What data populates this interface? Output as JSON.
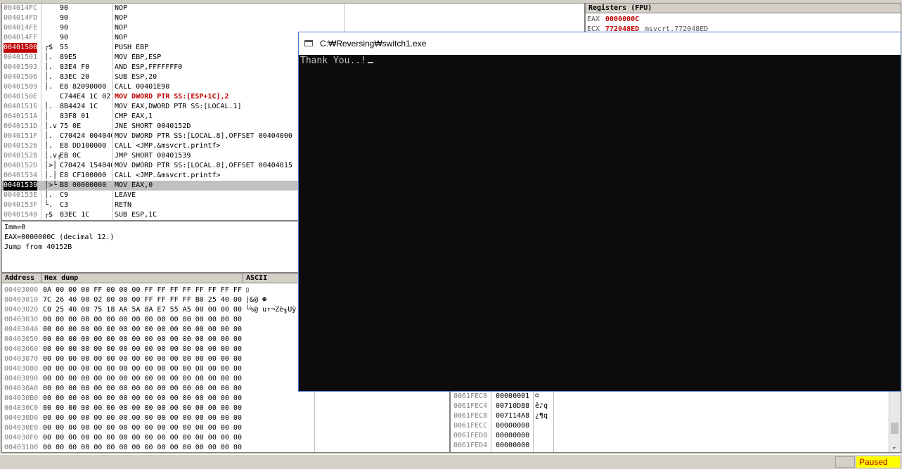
{
  "console": {
    "title": "C:₩Reversing₩switch1.exe",
    "output": "Thank You..!"
  },
  "disasm": {
    "rows": [
      {
        "addr": "004014FC",
        "arrow": "",
        "hex": "90",
        "asm": "NOP"
      },
      {
        "addr": "004014FD",
        "arrow": "",
        "hex": "90",
        "asm": "NOP"
      },
      {
        "addr": "004014FE",
        "arrow": "",
        "hex": "90",
        "asm": "NOP"
      },
      {
        "addr": "004014FF",
        "arrow": "",
        "hex": "90",
        "asm": "NOP"
      },
      {
        "addr": "00401500",
        "arrow": "┌$",
        "hex": "55",
        "asm": "PUSH EBP",
        "state": "eip"
      },
      {
        "addr": "00401501",
        "arrow": "│.",
        "hex": "89E5",
        "asm": "MOV EBP,ESP"
      },
      {
        "addr": "00401503",
        "arrow": "│.",
        "hex": "83E4 F0",
        "asm": "AND ESP,FFFFFFF0"
      },
      {
        "addr": "00401506",
        "arrow": "│.",
        "hex": "83EC 20",
        "asm": "SUB ESP,20"
      },
      {
        "addr": "00401509",
        "arrow": "│.",
        "hex": "E8 82090000",
        "asm": "CALL 00401E90"
      },
      {
        "addr": "0040150E",
        "arrow": " ",
        "hex": "C744E4 1C 02",
        "asm": "MOV DWORD PTR SS:[ESP+1C],2",
        "red": true
      },
      {
        "addr": "00401516",
        "arrow": "│.",
        "hex": "8B4424 1C",
        "asm": "MOV EAX,DWORD PTR SS:[LOCAL.1]"
      },
      {
        "addr": "0040151A",
        "arrow": "│",
        "hex": "83F8 01",
        "asm": "CMP EAX,1"
      },
      {
        "addr": "0040151D",
        "arrow": "│.v",
        "hex": "75 0E",
        "asm": "JNE SHORT 0040152D"
      },
      {
        "addr": "0040151F",
        "arrow": "│.",
        "hex": "C70424 004040",
        "asm": "MOV DWORD PTR SS:[LOCAL.8],OFFSET 00404000"
      },
      {
        "addr": "00401526",
        "arrow": "│.",
        "hex": "E8 DD100000",
        "asm": "CALL <JMP.&msvcrt.printf>"
      },
      {
        "addr": "0040152B",
        "arrow": "│.v┌",
        "hex": "EB 0C",
        "asm": "JMP SHORT 00401539"
      },
      {
        "addr": "0040152D",
        "arrow": "│>│",
        "hex": "C70424 154040",
        "asm": "MOV DWORD PTR SS:[LOCAL.8],OFFSET 00404015"
      },
      {
        "addr": "00401534",
        "arrow": "│.│",
        "hex": "E8 CF100000",
        "asm": "CALL <JMP.&msvcrt.printf>"
      },
      {
        "addr": "00401539",
        "arrow": "│>└",
        "hex": "B8 00000000",
        "asm": "MOV EAX,0",
        "state": "sel"
      },
      {
        "addr": "0040153E",
        "arrow": "│.",
        "hex": "C9",
        "asm": "LEAVE"
      },
      {
        "addr": "0040153F",
        "arrow": "└.",
        "hex": "C3",
        "asm": "RETN"
      },
      {
        "addr": "00401540",
        "arrow": "┌$",
        "hex": "83EC 1C",
        "asm": "SUB ESP,1C"
      }
    ]
  },
  "info": {
    "lines": [
      "Imm=0",
      "EAX=0000000C (decimal 12.)",
      "Jump from 40152B"
    ]
  },
  "dump": {
    "headers": {
      "address": "Address",
      "hex": "Hex dump",
      "ascii": "ASCII"
    },
    "rows": [
      {
        "addr": "00403000",
        "hex": "0A 00 00 00 FF 00 00 00 FF FF FF FF FF FF FF FF",
        "ascii": "▯"
      },
      {
        "addr": "00403010",
        "hex": "7C 26 40 00 02 00 00 00 FF FF FF FF B0 25 40 00",
        "ascii": "|&@ ☻"
      },
      {
        "addr": "00403020",
        "hex": "C0 25 40 00 75 18 AA 5A 8A E7 55 A5 00 00 00 00",
        "ascii": "└%@ u↑¬Zè╖Uÿ"
      },
      {
        "addr": "00403030",
        "hex": "00 00 00 00 00 00 00 00 00 00 00 00 00 00 00 00",
        "ascii": ""
      },
      {
        "addr": "00403040",
        "hex": "00 00 00 00 00 00 00 00 00 00 00 00 00 00 00 00",
        "ascii": ""
      },
      {
        "addr": "00403050",
        "hex": "00 00 00 00 00 00 00 00 00 00 00 00 00 00 00 00",
        "ascii": ""
      },
      {
        "addr": "00403060",
        "hex": "00 00 00 00 00 00 00 00 00 00 00 00 00 00 00 00",
        "ascii": ""
      },
      {
        "addr": "00403070",
        "hex": "00 00 00 00 00 00 00 00 00 00 00 00 00 00 00 00",
        "ascii": ""
      },
      {
        "addr": "00403080",
        "hex": "00 00 00 00 00 00 00 00 00 00 00 00 00 00 00 00",
        "ascii": ""
      },
      {
        "addr": "00403090",
        "hex": "00 00 00 00 00 00 00 00 00 00 00 00 00 00 00 00",
        "ascii": ""
      },
      {
        "addr": "004030A0",
        "hex": "00 00 00 00 00 00 00 00 00 00 00 00 00 00 00 00",
        "ascii": ""
      },
      {
        "addr": "004030B0",
        "hex": "00 00 00 00 00 00 00 00 00 00 00 00 00 00 00 00",
        "ascii": ""
      },
      {
        "addr": "004030C0",
        "hex": "00 00 00 00 00 00 00 00 00 00 00 00 00 00 00 00",
        "ascii": ""
      },
      {
        "addr": "004030D0",
        "hex": "00 00 00 00 00 00 00 00 00 00 00 00 00 00 00 00",
        "ascii": ""
      },
      {
        "addr": "004030E0",
        "hex": "00 00 00 00 00 00 00 00 00 00 00 00 00 00 00 00",
        "ascii": ""
      },
      {
        "addr": "004030F0",
        "hex": "00 00 00 00 00 00 00 00 00 00 00 00 00 00 00 00",
        "ascii": ""
      },
      {
        "addr": "00403100",
        "hex": "00 00 00 00 00 00 00 00 00 00 00 00 00 00 00 00",
        "ascii": ""
      }
    ]
  },
  "registers": {
    "header": "Registers (FPU)",
    "rows": [
      {
        "name": "EAX",
        "value": "0000000C",
        "comment": ""
      },
      {
        "name": "ECX",
        "value": "772048ED",
        "comment": "msvcrt.772048ED"
      }
    ]
  },
  "stack": {
    "rows": [
      {
        "addr": "0061FEC0",
        "value": "00000001",
        "comment": "☺"
      },
      {
        "addr": "0061FEC4",
        "value": "00710D88",
        "comment": "ê♪q"
      },
      {
        "addr": "0061FEC8",
        "value": "007114A8",
        "comment": "¿¶q"
      },
      {
        "addr": "0061FECC",
        "value": "00000000",
        "comment": ""
      },
      {
        "addr": "0061FED0",
        "value": "00000000",
        "comment": ""
      },
      {
        "addr": "0061FED4",
        "value": "00000000",
        "comment": ""
      }
    ]
  },
  "status": {
    "state": "Paused"
  }
}
